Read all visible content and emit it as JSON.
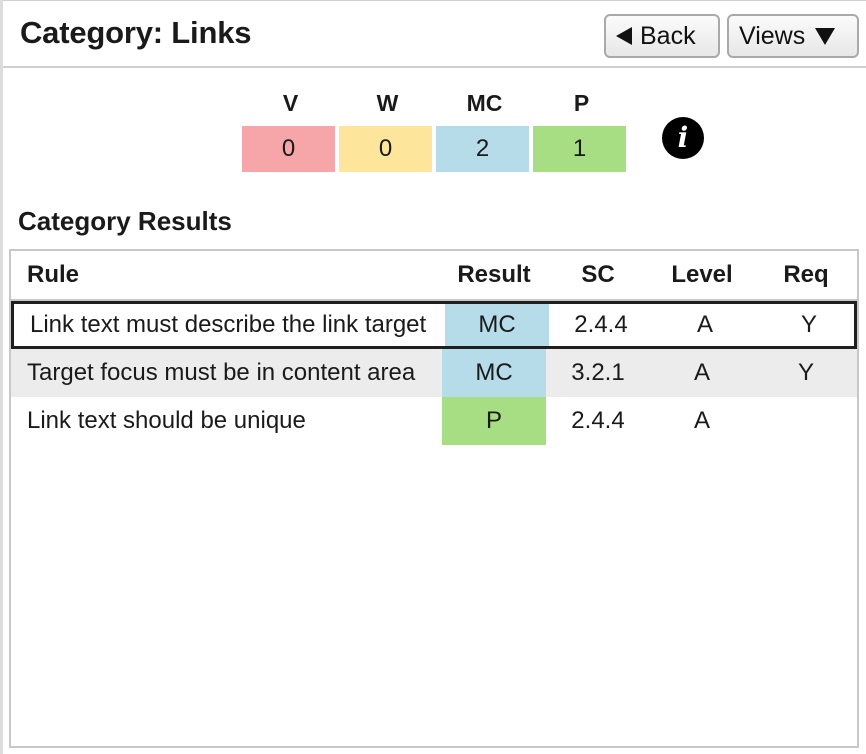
{
  "header": {
    "title": "Category: Links",
    "back_label": "Back",
    "views_label": "Views"
  },
  "summary": [
    {
      "label": "V",
      "value": "0",
      "color": "#f6a5a9"
    },
    {
      "label": "W",
      "value": "0",
      "color": "#fde59b"
    },
    {
      "label": "MC",
      "value": "2",
      "color": "#b6dbe9"
    },
    {
      "label": "P",
      "value": "1",
      "color": "#a7de83"
    }
  ],
  "info_icon": "info-icon",
  "results": {
    "title": "Category Results",
    "columns": {
      "rule": "Rule",
      "result": "Result",
      "sc": "SC",
      "level": "Level",
      "req": "Req"
    },
    "rows": [
      {
        "rule": "Link text must describe the link target",
        "result": "MC",
        "sc": "2.4.4",
        "level": "A",
        "req": "Y",
        "selected": true
      },
      {
        "rule": "Target focus must be in content area",
        "result": "MC",
        "sc": "3.2.1",
        "level": "A",
        "req": "Y",
        "selected": false
      },
      {
        "rule": "Link text should be unique",
        "result": "P",
        "sc": "2.4.4",
        "level": "A",
        "req": "",
        "selected": false
      }
    ]
  },
  "colors": {
    "violation": "#f6a5a9",
    "warning": "#fde59b",
    "manual_check": "#b6dbe9",
    "pass": "#a7de83",
    "alt_row": "#ececec"
  }
}
